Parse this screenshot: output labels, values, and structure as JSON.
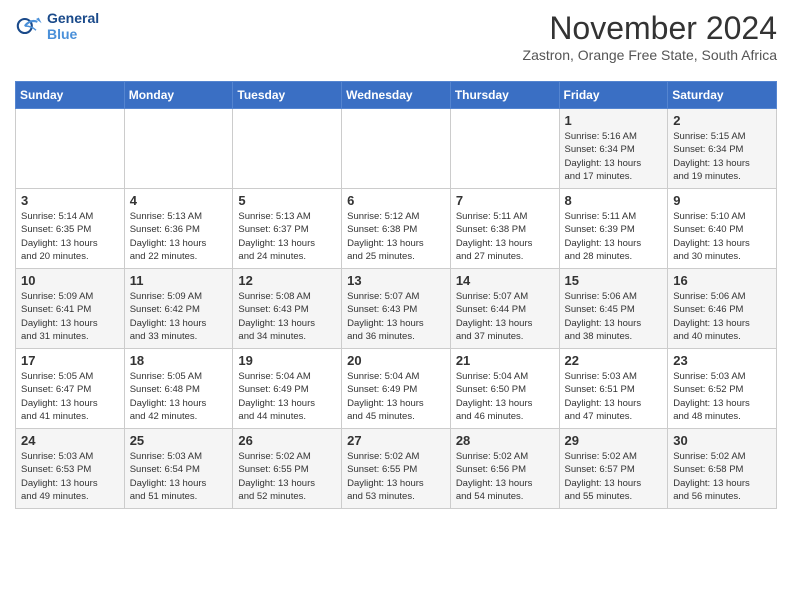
{
  "header": {
    "logo_line1": "General",
    "logo_line2": "Blue",
    "month_title": "November 2024",
    "location": "Zastron, Orange Free State, South Africa"
  },
  "weekdays": [
    "Sunday",
    "Monday",
    "Tuesday",
    "Wednesday",
    "Thursday",
    "Friday",
    "Saturday"
  ],
  "weeks": [
    {
      "days": [
        {
          "num": "",
          "info": ""
        },
        {
          "num": "",
          "info": ""
        },
        {
          "num": "",
          "info": ""
        },
        {
          "num": "",
          "info": ""
        },
        {
          "num": "",
          "info": ""
        },
        {
          "num": "1",
          "info": "Sunrise: 5:16 AM\nSunset: 6:34 PM\nDaylight: 13 hours\nand 17 minutes."
        },
        {
          "num": "2",
          "info": "Sunrise: 5:15 AM\nSunset: 6:34 PM\nDaylight: 13 hours\nand 19 minutes."
        }
      ]
    },
    {
      "days": [
        {
          "num": "3",
          "info": "Sunrise: 5:14 AM\nSunset: 6:35 PM\nDaylight: 13 hours\nand 20 minutes."
        },
        {
          "num": "4",
          "info": "Sunrise: 5:13 AM\nSunset: 6:36 PM\nDaylight: 13 hours\nand 22 minutes."
        },
        {
          "num": "5",
          "info": "Sunrise: 5:13 AM\nSunset: 6:37 PM\nDaylight: 13 hours\nand 24 minutes."
        },
        {
          "num": "6",
          "info": "Sunrise: 5:12 AM\nSunset: 6:38 PM\nDaylight: 13 hours\nand 25 minutes."
        },
        {
          "num": "7",
          "info": "Sunrise: 5:11 AM\nSunset: 6:38 PM\nDaylight: 13 hours\nand 27 minutes."
        },
        {
          "num": "8",
          "info": "Sunrise: 5:11 AM\nSunset: 6:39 PM\nDaylight: 13 hours\nand 28 minutes."
        },
        {
          "num": "9",
          "info": "Sunrise: 5:10 AM\nSunset: 6:40 PM\nDaylight: 13 hours\nand 30 minutes."
        }
      ]
    },
    {
      "days": [
        {
          "num": "10",
          "info": "Sunrise: 5:09 AM\nSunset: 6:41 PM\nDaylight: 13 hours\nand 31 minutes."
        },
        {
          "num": "11",
          "info": "Sunrise: 5:09 AM\nSunset: 6:42 PM\nDaylight: 13 hours\nand 33 minutes."
        },
        {
          "num": "12",
          "info": "Sunrise: 5:08 AM\nSunset: 6:43 PM\nDaylight: 13 hours\nand 34 minutes."
        },
        {
          "num": "13",
          "info": "Sunrise: 5:07 AM\nSunset: 6:43 PM\nDaylight: 13 hours\nand 36 minutes."
        },
        {
          "num": "14",
          "info": "Sunrise: 5:07 AM\nSunset: 6:44 PM\nDaylight: 13 hours\nand 37 minutes."
        },
        {
          "num": "15",
          "info": "Sunrise: 5:06 AM\nSunset: 6:45 PM\nDaylight: 13 hours\nand 38 minutes."
        },
        {
          "num": "16",
          "info": "Sunrise: 5:06 AM\nSunset: 6:46 PM\nDaylight: 13 hours\nand 40 minutes."
        }
      ]
    },
    {
      "days": [
        {
          "num": "17",
          "info": "Sunrise: 5:05 AM\nSunset: 6:47 PM\nDaylight: 13 hours\nand 41 minutes."
        },
        {
          "num": "18",
          "info": "Sunrise: 5:05 AM\nSunset: 6:48 PM\nDaylight: 13 hours\nand 42 minutes."
        },
        {
          "num": "19",
          "info": "Sunrise: 5:04 AM\nSunset: 6:49 PM\nDaylight: 13 hours\nand 44 minutes."
        },
        {
          "num": "20",
          "info": "Sunrise: 5:04 AM\nSunset: 6:49 PM\nDaylight: 13 hours\nand 45 minutes."
        },
        {
          "num": "21",
          "info": "Sunrise: 5:04 AM\nSunset: 6:50 PM\nDaylight: 13 hours\nand 46 minutes."
        },
        {
          "num": "22",
          "info": "Sunrise: 5:03 AM\nSunset: 6:51 PM\nDaylight: 13 hours\nand 47 minutes."
        },
        {
          "num": "23",
          "info": "Sunrise: 5:03 AM\nSunset: 6:52 PM\nDaylight: 13 hours\nand 48 minutes."
        }
      ]
    },
    {
      "days": [
        {
          "num": "24",
          "info": "Sunrise: 5:03 AM\nSunset: 6:53 PM\nDaylight: 13 hours\nand 49 minutes."
        },
        {
          "num": "25",
          "info": "Sunrise: 5:03 AM\nSunset: 6:54 PM\nDaylight: 13 hours\nand 51 minutes."
        },
        {
          "num": "26",
          "info": "Sunrise: 5:02 AM\nSunset: 6:55 PM\nDaylight: 13 hours\nand 52 minutes."
        },
        {
          "num": "27",
          "info": "Sunrise: 5:02 AM\nSunset: 6:55 PM\nDaylight: 13 hours\nand 53 minutes."
        },
        {
          "num": "28",
          "info": "Sunrise: 5:02 AM\nSunset: 6:56 PM\nDaylight: 13 hours\nand 54 minutes."
        },
        {
          "num": "29",
          "info": "Sunrise: 5:02 AM\nSunset: 6:57 PM\nDaylight: 13 hours\nand 55 minutes."
        },
        {
          "num": "30",
          "info": "Sunrise: 5:02 AM\nSunset: 6:58 PM\nDaylight: 13 hours\nand 56 minutes."
        }
      ]
    }
  ]
}
